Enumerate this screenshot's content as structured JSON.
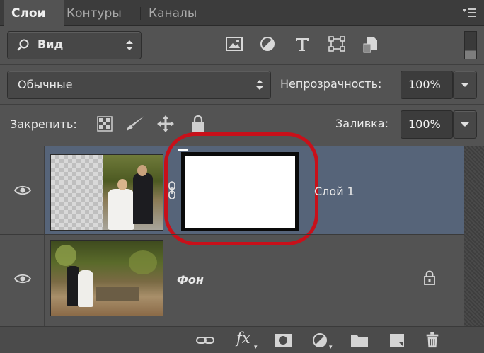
{
  "tabs": [
    {
      "label": "Слои",
      "active": true
    },
    {
      "label": "Контуры",
      "active": false
    },
    {
      "label": "Каналы",
      "active": false
    }
  ],
  "filter": {
    "kind_label": "Вид",
    "icons": [
      "image-filter-icon",
      "adjustment-filter-icon",
      "type-filter-icon",
      "shape-filter-icon",
      "smart-object-filter-icon"
    ]
  },
  "blend": {
    "mode": "Обычные",
    "opacity_label": "Непрозрачность:",
    "opacity_value": "100%"
  },
  "lock": {
    "label": "Закрепить:",
    "fill_label": "Заливка:",
    "fill_value": "100%",
    "icons": [
      "lock-transparent-pixels-icon",
      "lock-image-pixels-icon",
      "lock-position-icon",
      "lock-all-icon"
    ]
  },
  "layers": [
    {
      "name": "Слой 1",
      "selected": true,
      "has_mask": true,
      "visible": true
    },
    {
      "name": "Фон",
      "selected": false,
      "locked": true,
      "visible": true
    }
  ],
  "colors": {
    "panel": "#535353",
    "selected_row": "#566479",
    "highlight_ring": "#c8101a"
  },
  "bottom_icons": [
    "link-layers-icon",
    "fx-icon",
    "add-mask-icon",
    "adjustment-layer-icon",
    "new-group-icon",
    "new-layer-icon",
    "delete-layer-icon"
  ],
  "fx_label": "fx"
}
